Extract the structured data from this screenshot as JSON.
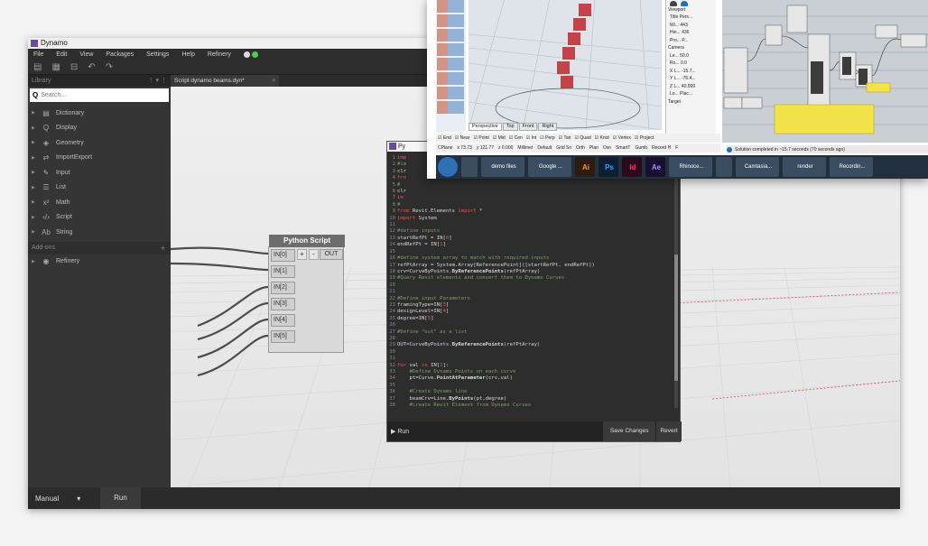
{
  "dynamo": {
    "window_title": "Dynamo",
    "menu": [
      "File",
      "Edit",
      "View",
      "Packages",
      "Settings",
      "Help",
      "Refinery"
    ],
    "library_title": "Library",
    "search_placeholder": "Search...",
    "categories": [
      {
        "label": "Dictionary",
        "icon": "dictionary-icon",
        "glyph": "▤"
      },
      {
        "label": "Display",
        "icon": "display-icon",
        "glyph": "Q"
      },
      {
        "label": "Geometry",
        "icon": "geometry-icon",
        "glyph": "◈"
      },
      {
        "label": "ImportExport",
        "icon": "import-export-icon",
        "glyph": "⇄"
      },
      {
        "label": "Input",
        "icon": "input-icon",
        "glyph": "✎"
      },
      {
        "label": "List",
        "icon": "list-icon",
        "glyph": "☰"
      },
      {
        "label": "Math",
        "icon": "math-icon",
        "glyph": "x²"
      },
      {
        "label": "Script",
        "icon": "script-icon",
        "glyph": "‹/›"
      },
      {
        "label": "String",
        "icon": "string-icon",
        "glyph": "Ab"
      }
    ],
    "addons_label": "Add-ons",
    "addon_items": [
      {
        "label": "Refinery",
        "icon": "refinery-icon",
        "glyph": "◉"
      }
    ],
    "tab_label": "Script dynamo beams.dyn*",
    "run_mode": "Manual",
    "run_button": "Run"
  },
  "node": {
    "title": "Python Script",
    "inputs": [
      "IN[0]",
      "IN[1]",
      "IN[2]",
      "IN[3]",
      "IN[4]",
      "IN[5]"
    ],
    "plus": "+",
    "minus": "-",
    "output": "OUT"
  },
  "editor": {
    "title": "Py",
    "lines": [
      {
        "n": "1",
        "html": "<span class='kw'>imp</span>"
      },
      {
        "n": "2",
        "html": "<span class='cm'>#im</span>"
      },
      {
        "n": "3",
        "html": "clr"
      },
      {
        "n": "4",
        "html": "<span class='kw'>fro</span>"
      },
      {
        "n": "5",
        "html": "<span class='cm'>#</span>"
      },
      {
        "n": "6",
        "html": "clr"
      },
      {
        "n": "7",
        "html": "<span class='kw'>im</span>"
      },
      {
        "n": "8",
        "html": "<span class='cm'>#</span>"
      },
      {
        "n": "9",
        "html": "<span class='kw'>from</span> Revit.Elements <span class='kw'>import</span> *"
      },
      {
        "n": "10",
        "html": "<span class='kw'>import</span> System"
      },
      {
        "n": "11",
        "html": ""
      },
      {
        "n": "12",
        "html": "<span class='cm'>#define inputs</span>"
      },
      {
        "n": "13",
        "html": "startRefPt = IN[<span class='kw'>0</span>]"
      },
      {
        "n": "14",
        "html": "endRefPt = IN[<span class='kw'>1</span>]"
      },
      {
        "n": "15",
        "html": ""
      },
      {
        "n": "16",
        "html": "<span class='cm'>#define system array to match with required inputs</span>"
      },
      {
        "n": "17",
        "html": "refPtArray = System.Array[ReferencePoint]([startRefPt, endRefPt])"
      },
      {
        "n": "18",
        "html": "crv=CurveByPoints.<span class='b'>ByReferencePoints</span>(refPtArray)"
      },
      {
        "n": "19",
        "html": "<span class='cm'>#Query Revit elements and convert them to Dynamo Curves</span>"
      },
      {
        "n": "20",
        "html": ""
      },
      {
        "n": "21",
        "html": ""
      },
      {
        "n": "22",
        "html": "<span class='cm'>#Define input Parameters</span>"
      },
      {
        "n": "23",
        "html": "framingType=IN[<span class='kw'>3</span>]"
      },
      {
        "n": "24",
        "html": "designLevel=IN[<span class='kw'>4</span>]"
      },
      {
        "n": "25",
        "html": "degree=IN[<span class='kw'>5</span>]"
      },
      {
        "n": "26",
        "html": ""
      },
      {
        "n": "27",
        "html": "<span class='cm'>#Define \"out\" as a list</span>"
      },
      {
        "n": "28",
        "html": ""
      },
      {
        "n": "29",
        "html": "OUT=CurveByPoints.<span class='b'>ByReferencePoints</span>(refPtArray)"
      },
      {
        "n": "30",
        "html": ""
      },
      {
        "n": "31",
        "html": ""
      },
      {
        "n": "32",
        "html": "<span class='kw'>for</span> val <span class='kw'>in</span> IN[<span class='kw'>2</span>]:"
      },
      {
        "n": "33",
        "html": "    <span class='cm'>#Define Dynamo Points on each curve</span>"
      },
      {
        "n": "34",
        "html": "    pt=Curve.<span class='b'>PointAtParameter</span>(crv,val)"
      },
      {
        "n": "35",
        "html": ""
      },
      {
        "n": "36",
        "html": "    <span class='cm'>#Create Dynamo line</span>"
      },
      {
        "n": "37",
        "html": "    beamCrv=Line.<span class='b'>ByPoints</span>(pt,degree)"
      },
      {
        "n": "38",
        "html": "    <span class='cm'>#create Revit Element from Dynamo Curves</span>"
      }
    ],
    "run_label": "Run",
    "save_label": "Save Changes",
    "revert_label": "Revert"
  },
  "rhino": {
    "viewport_tabs": [
      "Perspective",
      "Top",
      "Front",
      "Right"
    ],
    "props": {
      "viewport_header": "Viewport",
      "rows_viewport": [
        [
          "Title",
          "Pers..."
        ],
        [
          "Wi...",
          "443"
        ],
        [
          "Hei...",
          "436"
        ],
        [
          "Pro...",
          "P..."
        ]
      ],
      "camera_header": "Camera",
      "rows_camera": [
        [
          "Le...",
          "50.0"
        ],
        [
          "Ro...",
          "0.0"
        ],
        [
          "X L...",
          "-15.7..."
        ],
        [
          "Y L...",
          "-76.4..."
        ],
        [
          "Z L...",
          "40.999"
        ],
        [
          "Lo...",
          "Plac..."
        ]
      ],
      "target_header": "Target"
    },
    "osnaps": [
      "End",
      "Near",
      "Point",
      "Mid",
      "Cen",
      "Int",
      "Perp",
      "Tan",
      "Quad",
      "Knot",
      "Vertex",
      "Project"
    ],
    "status": [
      "CPlane",
      "x 73.73",
      "y 121.77",
      "z 0.000",
      "Millimet",
      "Default",
      "Grid Sn",
      "Orth",
      "Plan",
      "Osn",
      "SmartT",
      "Gumb",
      "Record H",
      "F"
    ],
    "gh_status": "Solution completed in ~15.7 seconds (70 seconds ago)"
  },
  "taskbar": {
    "items": [
      {
        "label": "",
        "icon": "windows-start-icon",
        "class": "start"
      },
      {
        "label": "",
        "icon": "calculator-icon",
        "class": ""
      },
      {
        "label": "demo files",
        "icon": "folder-icon",
        "class": "wide"
      },
      {
        "label": "Google ...",
        "icon": "chrome-icon",
        "class": "wide"
      },
      {
        "label": "Ai",
        "icon": "illustrator-icon",
        "class": "ai"
      },
      {
        "label": "Ps",
        "icon": "photoshop-icon",
        "class": "ps"
      },
      {
        "label": "Id",
        "icon": "indesign-icon",
        "class": "id"
      },
      {
        "label": "Ae",
        "icon": "after-effects-icon",
        "class": "ae"
      },
      {
        "label": "Rhinoce...",
        "icon": "rhino-icon",
        "class": "wide"
      },
      {
        "label": "",
        "icon": "app-icon",
        "class": ""
      },
      {
        "label": "Camtasia...",
        "icon": "camtasia-icon",
        "class": "wide"
      },
      {
        "label": "render",
        "icon": "render-icon",
        "class": "wide"
      },
      {
        "label": "Recordin...",
        "icon": "recording-icon",
        "class": "wide"
      }
    ]
  },
  "colors": {
    "dynamo_dark": "#2b2b2b",
    "accent_blue": "#1d71b8",
    "wire_highlight": "#3d8fe0",
    "grid_red": "#e04848"
  }
}
